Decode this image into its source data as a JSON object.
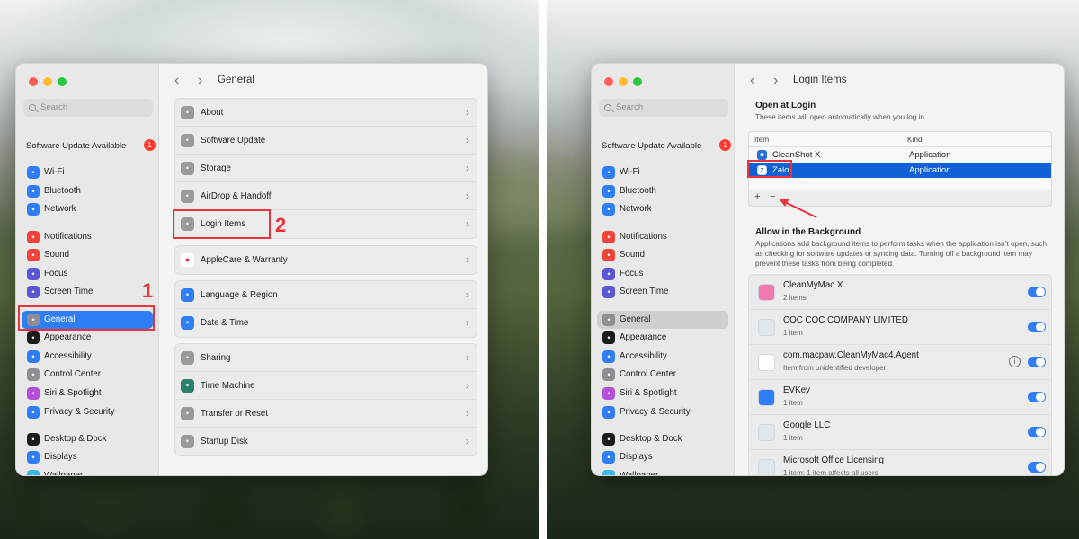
{
  "left": {
    "search_placeholder": "Search",
    "update": {
      "label": "Software Update Available",
      "count": "1"
    },
    "sidebar": [
      {
        "label": "Wi-Fi",
        "icon": "wifi-icon",
        "color": "#2f7ef5"
      },
      {
        "label": "Bluetooth",
        "icon": "bluetooth-icon",
        "color": "#2f7ef5"
      },
      {
        "label": "Network",
        "icon": "globe-icon",
        "color": "#2f7ef5"
      },
      {
        "label": "Notifications",
        "icon": "bell-icon",
        "color": "#f0443a"
      },
      {
        "label": "Sound",
        "icon": "speaker-icon",
        "color": "#f0443a"
      },
      {
        "label": "Focus",
        "icon": "moon-icon",
        "color": "#5a57d6"
      },
      {
        "label": "Screen Time",
        "icon": "hourglass-icon",
        "color": "#5a57d6"
      },
      {
        "label": "General",
        "icon": "gear-icon",
        "color": "#8e8e93"
      },
      {
        "label": "Appearance",
        "icon": "appearance-icon",
        "color": "#1c1c1e"
      },
      {
        "label": "Accessibility",
        "icon": "accessibility-icon",
        "color": "#2f7ef5"
      },
      {
        "label": "Control Center",
        "icon": "control-center-icon",
        "color": "#8e8e93"
      },
      {
        "label": "Siri & Spotlight",
        "icon": "siri-icon",
        "color": "#b34fd9"
      },
      {
        "label": "Privacy & Security",
        "icon": "hand-icon",
        "color": "#2f7ef5"
      },
      {
        "label": "Desktop & Dock",
        "icon": "dock-icon",
        "color": "#1c1c1e"
      },
      {
        "label": "Displays",
        "icon": "display-icon",
        "color": "#2f7ef5"
      },
      {
        "label": "Wallpaper",
        "icon": "wallpaper-icon",
        "color": "#38b6e8"
      }
    ],
    "title": "General",
    "groups": [
      [
        {
          "label": "About",
          "icon": "laptop-icon"
        },
        {
          "label": "Software Update",
          "icon": "gear-icon"
        },
        {
          "label": "Storage",
          "icon": "disk-icon"
        },
        {
          "label": "AirDrop & Handoff",
          "icon": "airdrop-icon"
        },
        {
          "label": "Login Items",
          "icon": "list-icon"
        }
      ],
      [
        {
          "label": "AppleCare & Warranty",
          "icon": "apple-icon"
        }
      ],
      [
        {
          "label": "Language & Region",
          "icon": "globe-icon"
        },
        {
          "label": "Date & Time",
          "icon": "calendar-icon"
        }
      ],
      [
        {
          "label": "Sharing",
          "icon": "share-icon"
        },
        {
          "label": "Time Machine",
          "icon": "clock-icon"
        },
        {
          "label": "Transfer or Reset",
          "icon": "reset-icon"
        },
        {
          "label": "Startup Disk",
          "icon": "disk-icon"
        }
      ]
    ],
    "step1": "1",
    "step2": "2"
  },
  "right": {
    "title": "Login Items",
    "open_at_login": {
      "title": "Open at Login",
      "subtitle": "These items will open automatically when you log in.",
      "columns": [
        "Item",
        "Kind"
      ],
      "rows": [
        {
          "name": "CleanShot X",
          "kind": "Application",
          "selected": false
        },
        {
          "name": "Zalo",
          "kind": "Application",
          "selected": true
        }
      ],
      "add": "+",
      "remove": "−"
    },
    "background": {
      "title": "Allow in the Background",
      "subtitle": "Applications add background items to perform tasks when the application isn’t open, such as checking for software updates or syncing data. Turning off a background item may prevent these tasks from being completed.",
      "items": [
        {
          "name": "CleanMyMac X",
          "sub": "2 items"
        },
        {
          "name": "COC COC COMPANY LIMITED",
          "sub": "1 item"
        },
        {
          "name": "com.macpaw.CleanMyMac4.Agent",
          "sub": "Item from unidentified developer."
        },
        {
          "name": "EVKey",
          "sub": "1 item"
        },
        {
          "name": "Google LLC",
          "sub": "1 item"
        },
        {
          "name": "Microsoft Office Licensing",
          "sub": "1 item: 1 item affects all users"
        }
      ]
    }
  },
  "colors": {
    "accent": "#2f7ef5",
    "highlight": "#e8323c",
    "selection": "#1060d6"
  }
}
